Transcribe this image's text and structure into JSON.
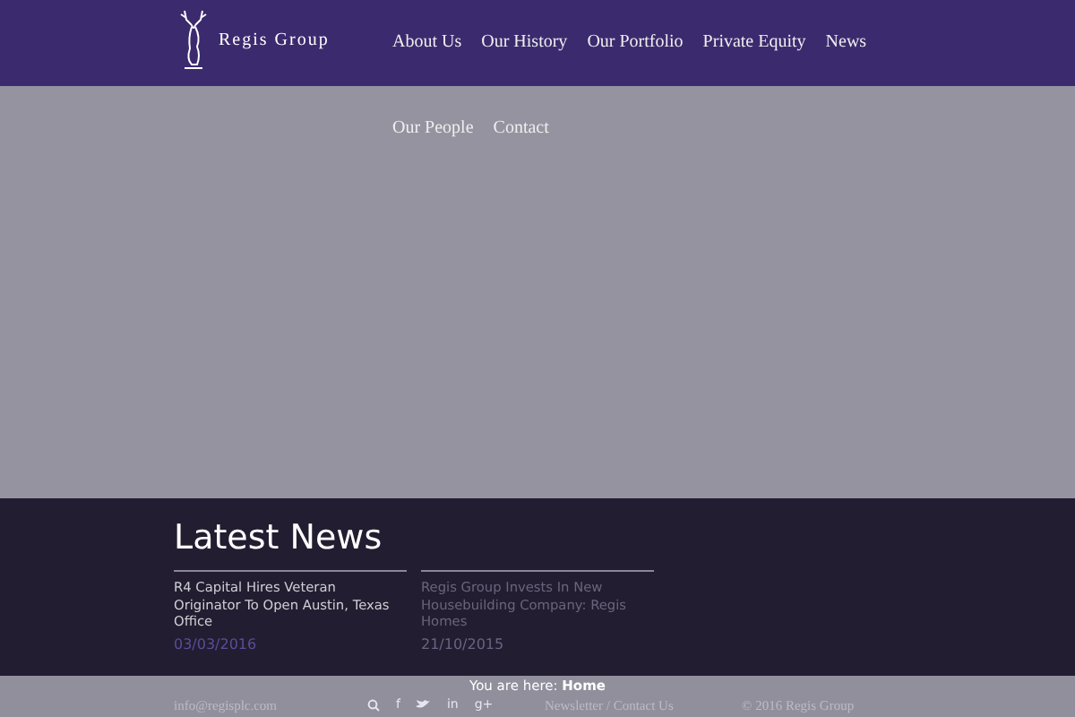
{
  "brand": {
    "name": "Regis Group"
  },
  "nav": [
    {
      "label": "About Us"
    },
    {
      "label": "Our History"
    },
    {
      "label": "Our Portfolio"
    },
    {
      "label": "Private Equity"
    },
    {
      "label": "News"
    },
    {
      "label": "Our People"
    },
    {
      "label": "Contact"
    }
  ],
  "latest_news": {
    "title": "Latest News",
    "items": [
      {
        "headline": "R4 Capital Hires Veteran Originator To Open Austin, Texas Office",
        "date": "03/03/2016",
        "active": true
      },
      {
        "headline": "Regis Group Invests In New Housebuilding Company: Regis Homes",
        "date": "21/10/2015",
        "active": false
      }
    ]
  },
  "breadcrumb": "You are here: **Home**",
  "footer": {
    "email": "info@regisplc.com",
    "social": [
      {
        "kind": "search"
      },
      {
        "kind": "glyph",
        "glyph": "f"
      },
      {
        "kind": "bird"
      },
      {
        "kind": "glyph",
        "glyph": "in"
      },
      {
        "kind": "glyph",
        "glyph": "g+"
      }
    ],
    "links": "Newsletter / Contact Us",
    "copyright": "© 2016 Regis Group"
  }
}
